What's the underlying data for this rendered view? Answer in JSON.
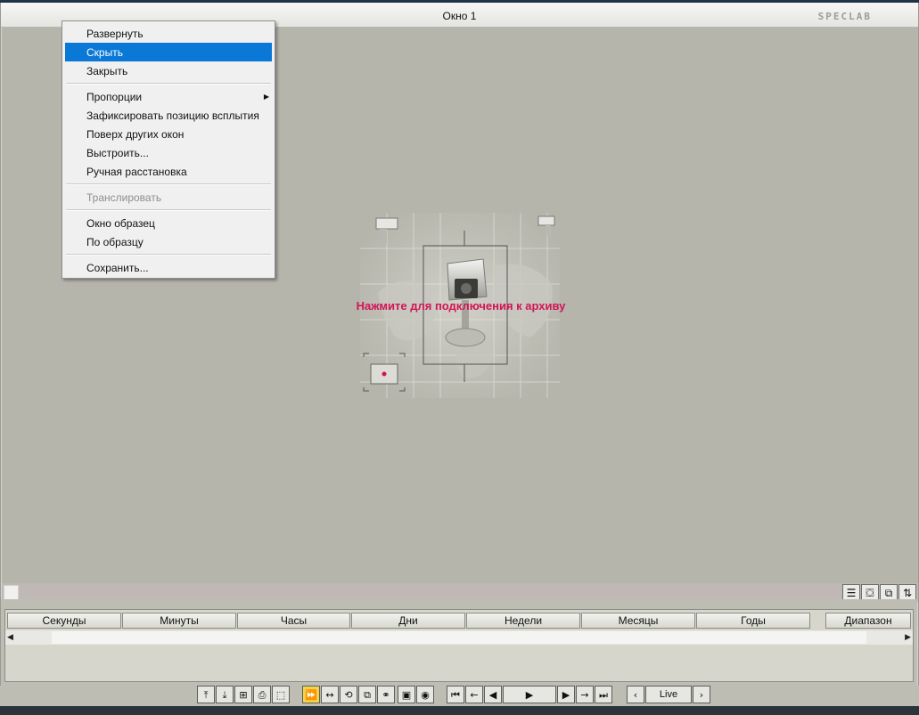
{
  "window": {
    "title": "Окно 1",
    "logo": "SPECLAB"
  },
  "context_menu": {
    "items": [
      {
        "label": "Развернуть"
      },
      {
        "label": "Скрыть",
        "selected": true
      },
      {
        "label": "Закрыть"
      },
      {
        "label": "Пропорции",
        "submenu": true
      },
      {
        "label": "Зафиксировать позицию всплытия"
      },
      {
        "label": "Поверх других окон"
      },
      {
        "label": "Выстроить..."
      },
      {
        "label": "Ручная расстановка"
      },
      {
        "label": "Транслировать",
        "disabled": true
      },
      {
        "label": "Окно образец"
      },
      {
        "label": "По образцу"
      },
      {
        "label": "Сохранить..."
      }
    ]
  },
  "video": {
    "connect_text": "Нажмите для подключения к архиву"
  },
  "view_buttons": [
    {
      "icon": "list-icon"
    },
    {
      "icon": "tv-icon"
    },
    {
      "icon": "windows-icon"
    },
    {
      "icon": "sort-arrows-icon"
    }
  ],
  "timeline": {
    "tabs": [
      "Секунды",
      "Минуты",
      "Часы",
      "Дни",
      "Недели",
      "Месяцы",
      "Годы"
    ],
    "range_tab": "Диапазон"
  },
  "toolbar": {
    "live_label": "Live",
    "active_color": "#f0d44a"
  },
  "colors": {
    "menu_selected": "#0a78d7",
    "connect_text": "#d31456",
    "view_background": "#b5b5ac"
  }
}
